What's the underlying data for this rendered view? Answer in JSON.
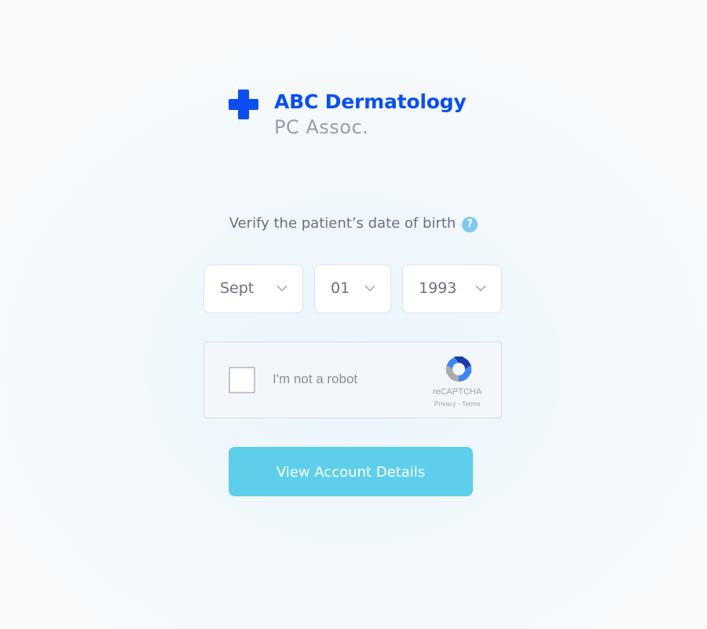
{
  "brand": {
    "name": "ABC Dermatology",
    "subtitle": "PC Assoc.",
    "accent_color": "#0a4ef0",
    "logo_icon": "medical-cross-icon"
  },
  "verify": {
    "prompt": "Verify the patient’s date of birth",
    "help_icon": "question-mark-icon",
    "help_glyph": "?"
  },
  "dob": {
    "month": "Sept",
    "day": "01",
    "year": "1993"
  },
  "captcha": {
    "label": "I'm not a robot",
    "checked": false,
    "brand": "reCAPTCHA",
    "links": "Privacy - Terms"
  },
  "submit": {
    "label": "View Account Details",
    "color": "#5ecfeb"
  }
}
